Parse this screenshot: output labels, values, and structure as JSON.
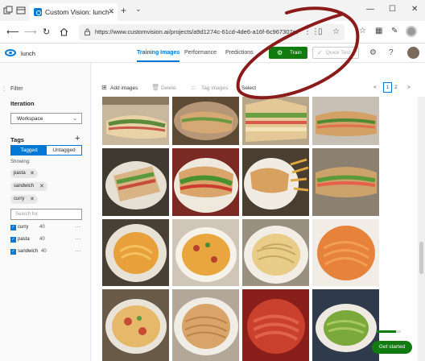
{
  "browser": {
    "tab_title": "Custom Vision: lunch - ",
    "tab_close": "✕",
    "new_tab": "+",
    "tab_menu": "⌄",
    "url": "https://www.customvision.ai/projects/a9d1274c-61cd-4de6-a16f-6c967307cce0#",
    "window_controls": [
      "—",
      "☐",
      "✕"
    ]
  },
  "app": {
    "project_name": "lunch",
    "tabs": [
      "Training Images",
      "Performance",
      "Predictions"
    ],
    "active_tab": "Training Images",
    "train_label": "Train",
    "quick_test_label": "Quick Test",
    "settings_icon": "gear-icon",
    "help_icon": "help-icon",
    "brand_color": "#0078d4",
    "train_color": "#107c10"
  },
  "sidebar": {
    "filter_label": "Filter",
    "iteration_label": "Iteration",
    "iteration_value": "Workspace",
    "tags_label": "Tags",
    "add_tag": "+",
    "segment": [
      "Tagged",
      "Untagged"
    ],
    "showing_label": "Showing:",
    "chips": [
      "pasta",
      "sandwich",
      "curry"
    ],
    "chip_remove": "✕",
    "search_placeholder": "Search for",
    "tag_list": [
      {
        "name": "curry",
        "count": "40"
      },
      {
        "name": "pasta",
        "count": "40"
      },
      {
        "name": "sandwich",
        "count": "40"
      }
    ],
    "more": "···"
  },
  "toolbar": {
    "add_images": "Add images",
    "delete": "Delete",
    "tag_images": "Tag images",
    "select": "Select",
    "pager_prev": "<",
    "page_current": "1",
    "page_next_num": "2",
    "pager_next": ">"
  },
  "grid": {
    "rows": [
      [
        "sandwich",
        "sandwich",
        "sandwich",
        "sandwich"
      ],
      [
        "sandwich",
        "sandwich",
        "sandwich",
        "sandwich"
      ],
      [
        "pasta",
        "pasta",
        "pasta",
        "pasta"
      ],
      [
        "pasta",
        "pasta",
        "pasta",
        "pasta"
      ]
    ]
  },
  "get_started": "Get started",
  "get_started_progress": 0.8
}
